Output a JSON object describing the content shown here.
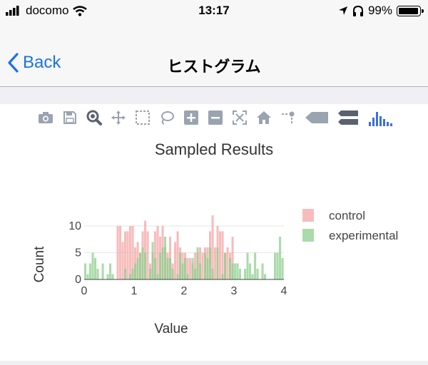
{
  "status_bar": {
    "carrier": "docomo",
    "time": "13:17",
    "battery": "99%"
  },
  "nav": {
    "back_label": "Back",
    "title": "ヒストグラム"
  },
  "modebar": {
    "buttons": [
      "camera-icon",
      "save-icon",
      "zoom-icon",
      "pan-icon",
      "box-select-icon",
      "lasso-icon",
      "zoom-in-icon",
      "zoom-out-icon",
      "autoscale-icon",
      "reset-axes-icon",
      "spike-lines-icon",
      "hover-closest-icon",
      "hover-compare-icon",
      "plotly-logo-icon"
    ]
  },
  "chart_data": {
    "type": "bar",
    "title": "Sampled Results",
    "xlabel": "Value",
    "ylabel": "Count",
    "xlim": [
      0,
      4
    ],
    "ylim": [
      0,
      12
    ],
    "xticks": [
      "0",
      "1",
      "2",
      "3",
      "4"
    ],
    "yticks": [
      "0",
      "5",
      "10"
    ],
    "bin_width": 0.05,
    "bin_start": 0,
    "barmode": "overlay",
    "legend_position": "top-right",
    "series": [
      {
        "name": "control",
        "color": "#f4a6a6",
        "values": [
          0,
          0,
          0,
          0,
          0,
          0,
          0,
          0,
          0,
          0,
          0,
          0,
          0,
          10,
          10,
          7,
          9,
          9,
          10,
          10,
          6,
          7,
          5,
          9,
          11,
          9,
          3,
          5,
          9,
          10,
          8,
          10,
          6,
          5,
          8,
          3,
          7,
          9,
          6,
          5,
          5,
          4,
          4,
          3,
          5,
          5,
          6,
          5,
          6,
          6,
          9,
          12,
          6,
          10,
          9,
          9,
          5,
          6,
          5,
          8,
          0,
          0,
          0,
          0,
          0,
          0,
          0,
          0,
          0,
          0,
          0,
          0,
          0,
          0,
          0,
          0,
          0,
          0,
          0,
          0
        ]
      },
      {
        "name": "experimental",
        "color": "#8fcf8f",
        "values": [
          3,
          1,
          3,
          5,
          4,
          2,
          0,
          3,
          0,
          1,
          3,
          1,
          0,
          0,
          0,
          0,
          2,
          0,
          1,
          2,
          3,
          4,
          5,
          6,
          5,
          0,
          2,
          7,
          4,
          1,
          5,
          6,
          8,
          4,
          4,
          2,
          0,
          1,
          5,
          3,
          4,
          1,
          0,
          4,
          2,
          6,
          3,
          0,
          5,
          4,
          6,
          2,
          0,
          6,
          0,
          1,
          5,
          0,
          4,
          3,
          3,
          3,
          2,
          0,
          2,
          5,
          3,
          1,
          5,
          2,
          0,
          3,
          1,
          0,
          0,
          0,
          5,
          5,
          8,
          4
        ]
      }
    ]
  }
}
